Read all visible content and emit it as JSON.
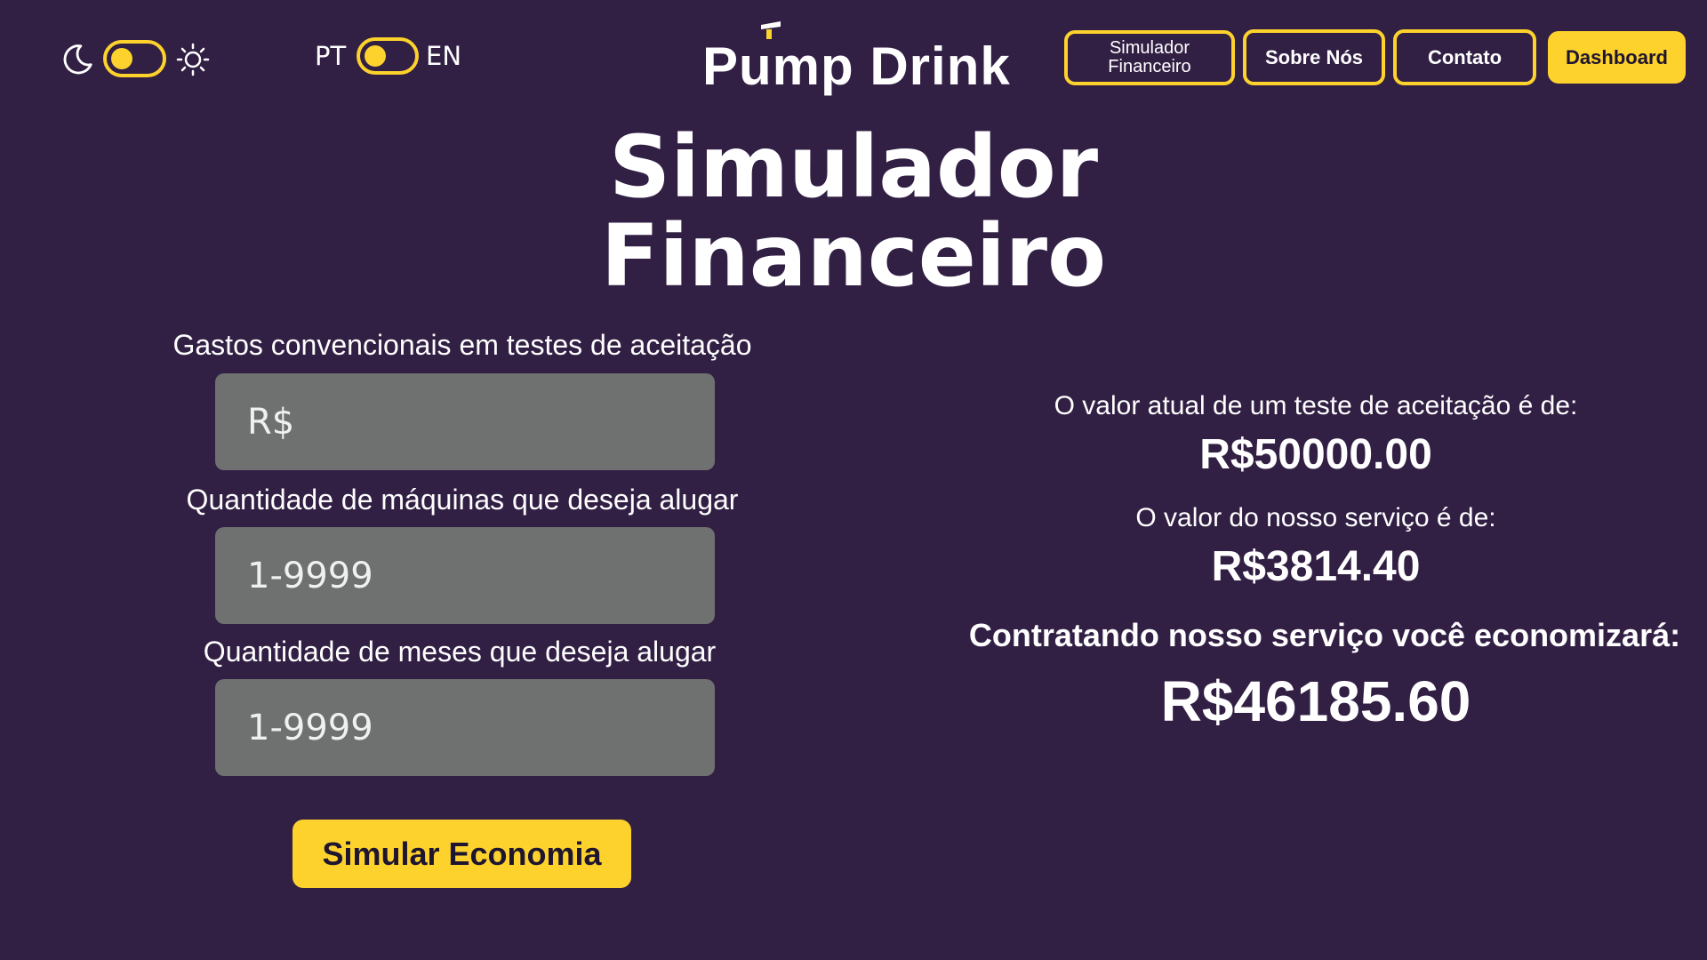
{
  "theme_toggle": {
    "dark_icon": "moon-icon",
    "light_icon": "sun-icon"
  },
  "language": {
    "left_label": "PT",
    "right_label": "EN"
  },
  "logo": {
    "text": "Pump Drink"
  },
  "nav": {
    "simulator_line1": "Simulador",
    "simulator_line2": "Financeiro",
    "about": "Sobre Nós",
    "contact": "Contato",
    "dashboard": "Dashboard"
  },
  "page": {
    "title_line1": "Simulador",
    "title_line2": "Financeiro"
  },
  "form": {
    "expenses_label": "Gastos convencionais em testes de aceitação",
    "expenses_placeholder": "R$",
    "machines_label": "Quantidade de máquinas que deseja alugar",
    "machines_placeholder": "1-9999",
    "months_label": "Quantidade de meses que deseja alugar",
    "months_placeholder": "1-9999",
    "submit_label": "Simular Economia"
  },
  "results": {
    "current_value_label": "O valor atual de um teste de aceitação é de:",
    "current_value": "R$50000.00",
    "service_value_label": "O valor do nosso serviço é de:",
    "service_value": "R$3814.40",
    "savings_label": "Contratando nosso serviço você economizará:",
    "savings_value": "R$46185.60"
  },
  "colors": {
    "background": "#311f44",
    "accent": "#fdd22c",
    "input_bg": "#6e7170"
  }
}
